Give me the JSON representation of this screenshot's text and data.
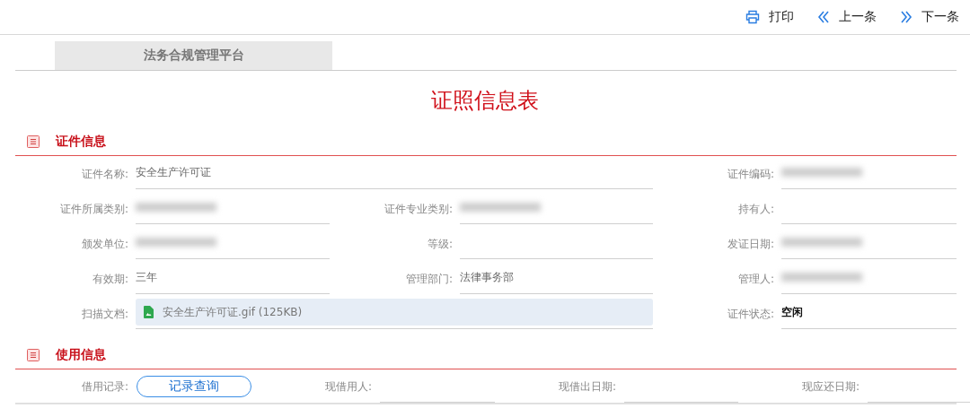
{
  "toolbar": [
    {
      "label": "打印",
      "kind": "print"
    },
    {
      "label": "上一条",
      "kind": "prev"
    },
    {
      "label": "下一条",
      "kind": "next"
    }
  ],
  "tab": {
    "label": "法务合规管理平台"
  },
  "title": "证照信息表",
  "sections": [
    {
      "title": "证件信息",
      "kind": "grid",
      "fields": [
        {
          "label": "证件名称:",
          "value": "安全生产许可证",
          "kind": "text",
          "wide": true
        },
        {
          "label": "证件编码:",
          "kind": "text",
          "redacted": true
        },
        {
          "label": "证件所属类别:",
          "kind": "text",
          "redacted": true
        },
        {
          "label": "证件专业类别:",
          "kind": "text",
          "redacted": true
        },
        {
          "label": "持有人:",
          "kind": "text"
        },
        {
          "label": "颁发单位:",
          "kind": "text",
          "redacted": true
        },
        {
          "label": "等级:",
          "kind": "text"
        },
        {
          "label": "发证日期:",
          "kind": "text",
          "redacted": true
        },
        {
          "label": "有效期:",
          "value": "三年",
          "kind": "text"
        },
        {
          "label": "管理部门:",
          "value": "法律事务部",
          "kind": "text"
        },
        {
          "label": "管理人:",
          "kind": "text",
          "redacted": true
        },
        {
          "label": "扫描文档:",
          "value": "安全生产许可证.gif (125KB)",
          "kind": "file",
          "wide": true
        },
        {
          "label": "证件状态:",
          "value": "空闲",
          "kind": "text",
          "emphasis": true
        }
      ]
    },
    {
      "title": "使用信息",
      "kind": "row",
      "fields": [
        {
          "label": "借用记录:",
          "value": "记录查询",
          "kind": "button"
        },
        {
          "label": "现借用人:",
          "kind": "text"
        },
        {
          "label": "现借出日期:",
          "kind": "text"
        },
        {
          "label": "现应还日期:",
          "kind": "text"
        }
      ]
    }
  ]
}
